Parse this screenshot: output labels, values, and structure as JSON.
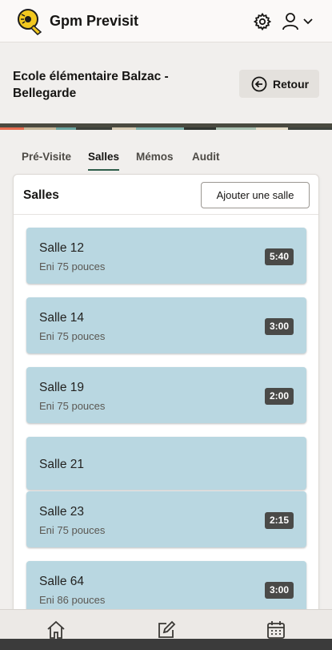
{
  "app": {
    "title": "Gpm Previsit"
  },
  "page": {
    "title": "Ecole élémentaire Balzac - Bellegarde",
    "back_label": "Retour"
  },
  "tabs": [
    {
      "label": "Pré-Visite",
      "active": false
    },
    {
      "label": "Salles",
      "active": true
    },
    {
      "label": "Mémos",
      "active": false
    },
    {
      "label": "Audit",
      "active": false
    }
  ],
  "rooms_section": {
    "title": "Salles",
    "add_label": "Ajouter une salle"
  },
  "rooms": [
    {
      "name": "Salle 12",
      "subtitle": "Eni 75 pouces",
      "duration": "5:40"
    },
    {
      "name": "Salle 14",
      "subtitle": "Eni 75 pouces",
      "duration": "3:00"
    },
    {
      "name": "Salle 19",
      "subtitle": "Eni 75 pouces",
      "duration": "2:00"
    },
    {
      "name": "Salle 21",
      "subtitle": "",
      "duration": ""
    },
    {
      "name": "Salle 23",
      "subtitle": "Eni 75 pouces",
      "duration": "2:15"
    },
    {
      "name": "Salle 64",
      "subtitle": "Eni 86 pouces",
      "duration": "3:00"
    }
  ],
  "bottom_nav": [
    {
      "icon": "home-icon"
    },
    {
      "icon": "edit-icon"
    },
    {
      "icon": "calendar-icon"
    }
  ],
  "colors": {
    "room_card": "#b9d7e1",
    "badge": "#4a4a48",
    "active_tab_underline": "#2e5d4a"
  }
}
